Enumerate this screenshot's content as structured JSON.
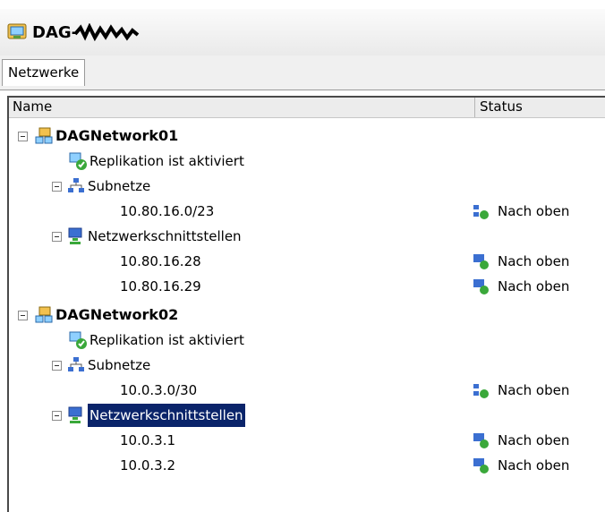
{
  "window": {
    "title": "DAG-"
  },
  "tabs": [
    {
      "label": "Netzwerke"
    }
  ],
  "columns": {
    "name": "Name",
    "status": "Status"
  },
  "networks": [
    {
      "name": "DAGNetwork01",
      "replication": "Replikation ist aktiviert",
      "subnets_label": "Subnetze",
      "subnets": [
        {
          "address": "10.80.16.0/23",
          "status": "Nach oben"
        }
      ],
      "interfaces_label": "Netzwerkschnittstellen",
      "interfaces": [
        {
          "address": "10.80.16.28",
          "status": "Nach oben"
        },
        {
          "address": "10.80.16.29",
          "status": "Nach oben"
        }
      ]
    },
    {
      "name": "DAGNetwork02",
      "replication": "Replikation ist aktiviert",
      "subnets_label": "Subnetze",
      "subnets": [
        {
          "address": "10.0.3.0/30",
          "status": "Nach oben"
        }
      ],
      "interfaces_label": "Netzwerkschnittstellen",
      "interfaces": [
        {
          "address": "10.0.3.1",
          "status": "Nach oben"
        },
        {
          "address": "10.0.3.2",
          "status": "Nach oben"
        }
      ],
      "interfaces_selected": true
    }
  ]
}
